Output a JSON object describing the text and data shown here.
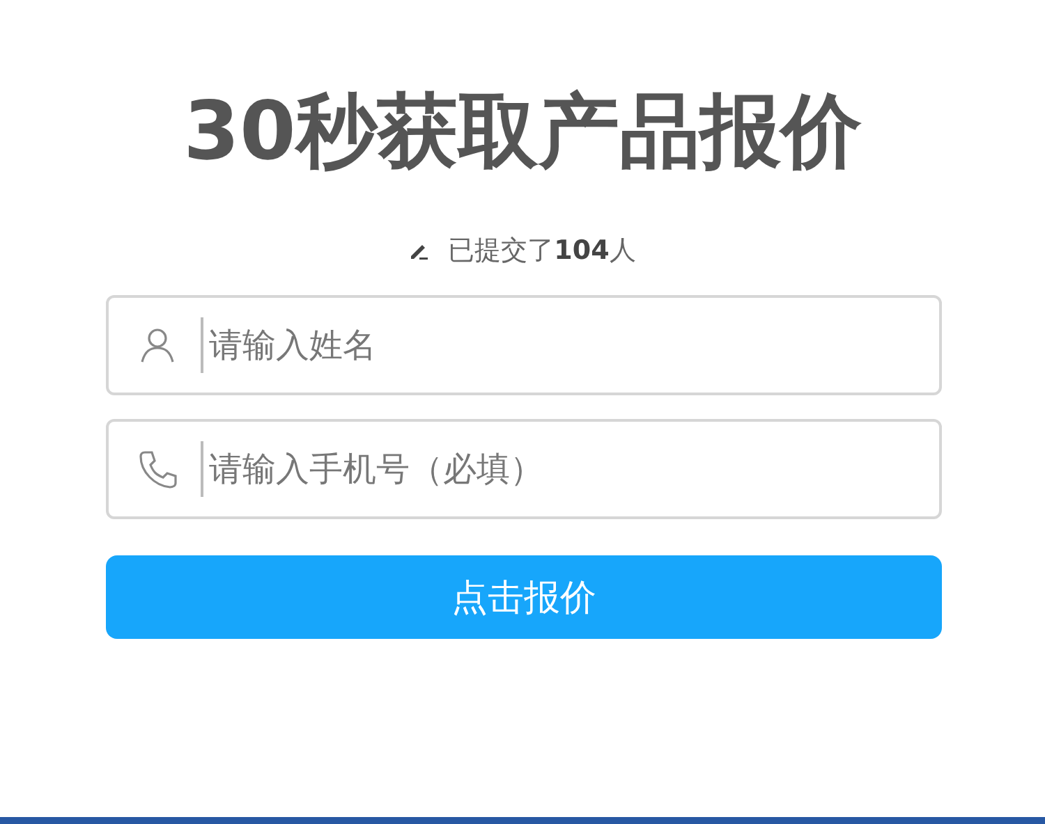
{
  "title": "30秒获取产品报价",
  "counter": "已提交了**104**人",
  "fields": [
    {
      "kind": "person",
      "placeholder": "请输入姓名"
    },
    {
      "kind": "phone",
      "placeholder": "请输入手机号（必填）"
    }
  ],
  "submit_button": "点击报价"
}
